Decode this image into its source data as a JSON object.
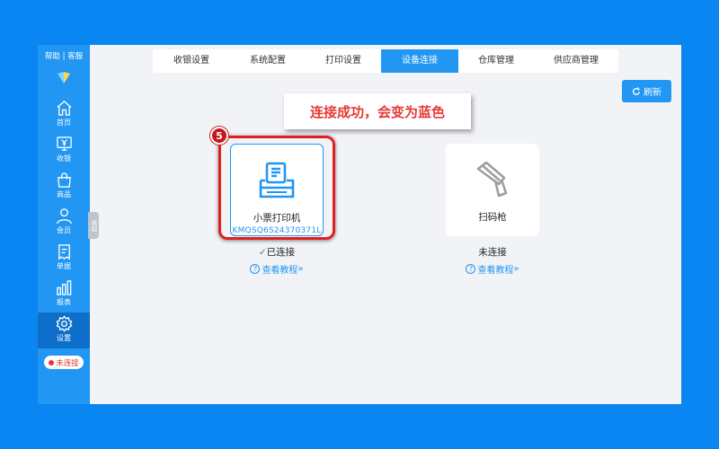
{
  "sidebar": {
    "help_link": "帮助",
    "separator": "|",
    "service_link": "客服",
    "items": [
      {
        "label": "首页",
        "icon": "home-icon"
      },
      {
        "label": "收银",
        "icon": "cashier-icon"
      },
      {
        "label": "商品",
        "icon": "shopping-bag-icon"
      },
      {
        "label": "会员",
        "icon": "user-icon"
      },
      {
        "label": "单据",
        "icon": "receipt-icon"
      },
      {
        "label": "报表",
        "icon": "bar-chart-icon"
      },
      {
        "label": "设置",
        "icon": "gear-icon",
        "active": true
      }
    ],
    "connection_status": "未连接",
    "collapse_label": "收起"
  },
  "tabs": [
    {
      "label": "收银设置"
    },
    {
      "label": "系统配置"
    },
    {
      "label": "打印设置"
    },
    {
      "label": "设备连接",
      "active": true
    },
    {
      "label": "仓库管理"
    },
    {
      "label": "供应商管理"
    }
  ],
  "refresh_label": "刷新",
  "annotation": {
    "step": "5",
    "text": "连接成功，会变为蓝色"
  },
  "devices": [
    {
      "name": "小票打印机",
      "serial": "KMQSQ6S24370371L",
      "status_mark": "✓",
      "status": "已连接",
      "tutorial": "查看教程",
      "icon": "printer-icon",
      "color": "#2196f3"
    },
    {
      "name": "扫码枪",
      "serial": "",
      "status_mark": "",
      "status": "未连接",
      "tutorial": "查看教程",
      "icon": "barcode-scanner-icon",
      "color": "#9e9e9e"
    }
  ],
  "colors": {
    "accent": "#2196f3",
    "background": "#0a86f3",
    "alert": "#e53935"
  }
}
